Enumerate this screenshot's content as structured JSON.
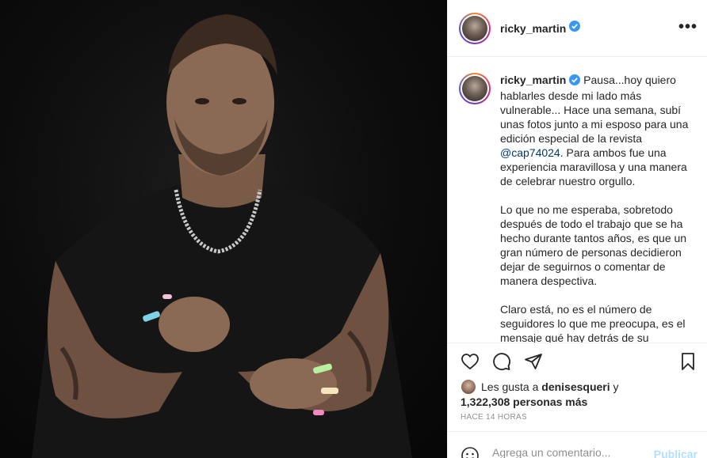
{
  "post": {
    "username": "ricky_martin",
    "verified": true,
    "more_label": "•••"
  },
  "caption": {
    "username": "ricky_martin",
    "para1_before": " Pausa...hoy quiero hablarles desde mi lado más vulnerable... Hace una semana, subí unas fotos junto a mi esposo para una edición especial de la revista ",
    "mention": "@cap74024",
    "para1_after": ". Para ambos fue una experiencia maravillosa y una manera de celebrar nuestro orgullo.",
    "para2": "Lo que no me esperaba, sobretodo después de todo el trabajo que se ha hecho durante tantos años, es que un gran número de personas decidieron dejar de seguirnos o comentar de manera despectiva.",
    "para3": "Claro está, no es el número de seguidores lo que me preocupa, es el mensaje qué hay detrás de su decisión."
  },
  "likes": {
    "prefix": "Les gusta a ",
    "first_user": "denisesqueri",
    "middle": " y",
    "count_text": "1,322,308 personas más"
  },
  "timestamp": "HACE 14 HORAS",
  "comment": {
    "placeholder": "Agrega un comentario...",
    "publish_label": "Publicar"
  },
  "icons": {
    "like": "heart-icon",
    "comment": "comment-icon",
    "share": "paper-plane-icon",
    "save": "bookmark-icon",
    "emoji": "emoji-icon",
    "verified": "verified-badge-icon"
  },
  "colors": {
    "verified_blue": "#3897f0",
    "mention_blue": "#00376b",
    "publish_disabled": "#b2dffc",
    "muted": "#8e8e8e"
  }
}
